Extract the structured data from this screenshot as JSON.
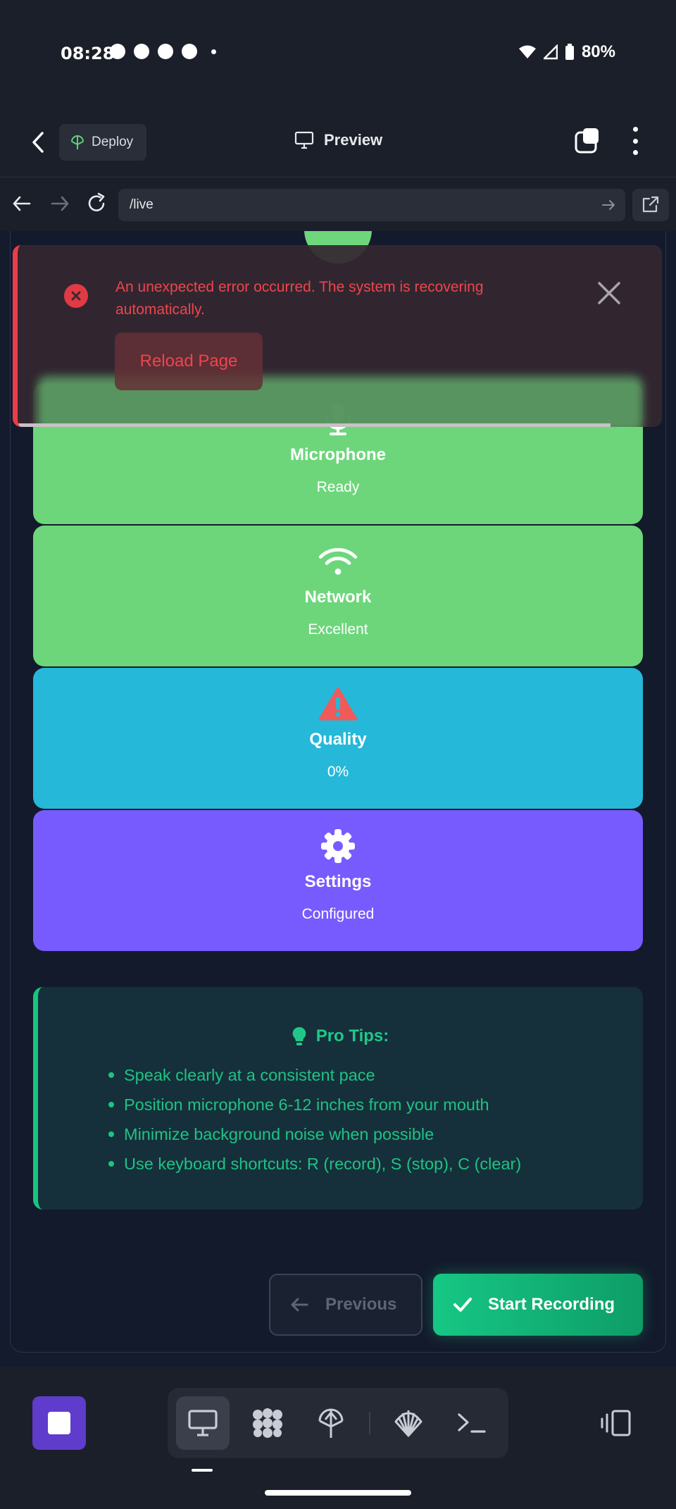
{
  "status_bar": {
    "time": "08:28",
    "battery": "80%"
  },
  "app_header": {
    "deploy_label": "Deploy",
    "title": "Preview"
  },
  "browser": {
    "url": "/live"
  },
  "status_cards": [
    {
      "title": "Microphone",
      "value": "Ready",
      "icon": "microphone-icon",
      "color": "#6dd67b"
    },
    {
      "title": "Network",
      "value": "Excellent",
      "icon": "wifi-icon",
      "color": "#6dd67b"
    },
    {
      "title": "Quality",
      "value": "0%",
      "icon": "warning-icon",
      "color": "#26b8d8"
    },
    {
      "title": "Settings",
      "value": "Configured",
      "icon": "gear-icon",
      "color": "#785bff"
    }
  ],
  "tips": {
    "title": "Pro Tips:",
    "items": [
      "Speak clearly at a consistent pace",
      "Position microphone 6-12 inches from your mouth",
      "Minimize background noise when possible",
      "Use keyboard shortcuts: R (record), S (stop), C (clear)"
    ]
  },
  "actions": {
    "previous_label": "Previous",
    "start_label": "Start Recording"
  },
  "error_toast": {
    "message": "An unexpected error occurred. The system is recovering automatically.",
    "reload_label": "Reload Page",
    "accent": "#ea3e48"
  }
}
